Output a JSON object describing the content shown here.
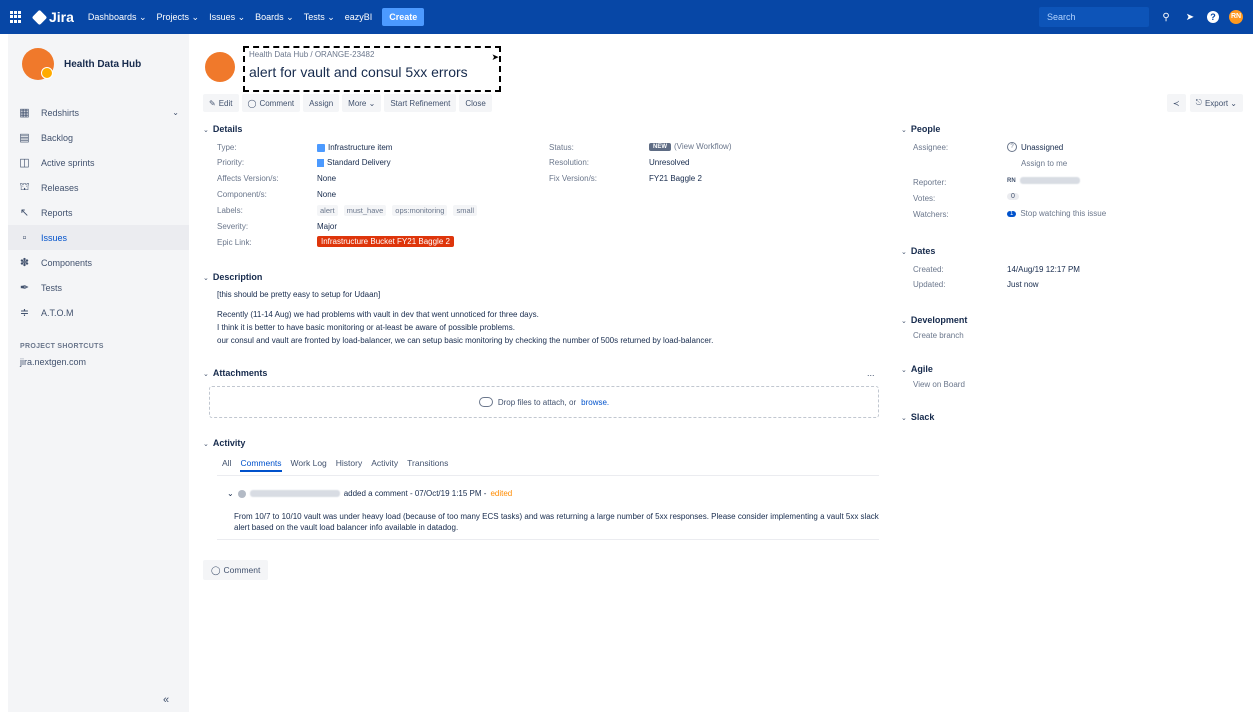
{
  "topnav": {
    "product": "Jira",
    "items": [
      "Dashboards ⌄",
      "Projects ⌄",
      "Issues ⌄",
      "Boards ⌄",
      "Tests ⌄",
      "eazyBI"
    ],
    "create": "Create",
    "search_placeholder": "Search",
    "user_initials": "RN"
  },
  "sidebar": {
    "project_name": "Health Data Hub",
    "items": [
      {
        "label": "Redshirts",
        "icon": "board-icon"
      },
      {
        "label": "Backlog",
        "icon": "backlog-icon"
      },
      {
        "label": "Active sprints",
        "icon": "sprint-icon"
      },
      {
        "label": "Releases",
        "icon": "ship-icon"
      },
      {
        "label": "Reports",
        "icon": "chart-icon"
      },
      {
        "label": "Issues",
        "icon": "issues-icon"
      },
      {
        "label": "Components",
        "icon": "puzzle-icon"
      },
      {
        "label": "Tests",
        "icon": "test-icon"
      },
      {
        "label": "A.T.O.M",
        "icon": "atom-icon"
      }
    ],
    "shortcuts_title": "PROJECT SHORTCUTS",
    "shortcut": "jira.nextgen.com",
    "collapse": "«"
  },
  "issue": {
    "breadcrumb": "Health Data Hub / ORANGE-23482",
    "title": "alert for vault and consul 5xx errors"
  },
  "toolbar": {
    "edit": "Edit",
    "comment": "Comment",
    "assign": "Assign",
    "more": "More ⌄",
    "start_refinement": "Start Refinement",
    "close": "Close",
    "export": "Export ⌄"
  },
  "details": {
    "heading": "Details",
    "type_label": "Type:",
    "type_value": "Infrastructure item",
    "priority_label": "Priority:",
    "priority_value": "Standard Delivery",
    "affects_label": "Affects Version/s:",
    "affects_value": "None",
    "component_label": "Component/s:",
    "component_value": "None",
    "labels_label": "Labels:",
    "labels": [
      "alert",
      "must_have",
      "ops:monitoring",
      "small"
    ],
    "severity_label": "Severity:",
    "severity_value": "Major",
    "epic_label": "Epic Link:",
    "epic_value": "Infrastructure Bucket FY21 Baggle 2",
    "status_label": "Status:",
    "status_badge": "NEW",
    "status_workflow": "(View Workflow)",
    "resolution_label": "Resolution:",
    "resolution_value": "Unresolved",
    "fix_label": "Fix Version/s:",
    "fix_value": "FY21 Baggle 2"
  },
  "description": {
    "heading": "Description",
    "lines": [
      "[this should be pretty easy to setup for Udaan]",
      "Recently (11-14 Aug) we had problems with vault in dev that went unnoticed for three days.",
      "I think it is better to have basic monitoring or at-least be aware of possible problems.",
      "our consul and vault are fronted by load-balancer, we can setup basic monitoring by checking the number of 500s returned by load-balancer."
    ]
  },
  "attachments": {
    "heading": "Attachments",
    "drop_text": "Drop files to attach, or",
    "browse": "browse.",
    "more": "..."
  },
  "activity": {
    "heading": "Activity",
    "tabs": [
      "All",
      "Comments",
      "Work Log",
      "History",
      "Activity",
      "Transitions"
    ],
    "comment_meta": "added a comment - 07/Oct/19 1:15 PM -",
    "edited": "edited",
    "comment_body": "From 10/7 to 10/10 vault was under heavy load (because of too many ECS tasks) and was returning a large number of 5xx responses. Please consider implementing a vault 5xx slack alert based on the vault load balancer info available in datadog.",
    "comment_button": "Comment"
  },
  "people": {
    "heading": "People",
    "assignee_label": "Assignee:",
    "assignee_value": "Unassigned",
    "assign_to_me": "Assign to me",
    "reporter_label": "Reporter:",
    "reporter_initials": "RN",
    "votes_label": "Votes:",
    "votes_value": "0",
    "watchers_label": "Watchers:",
    "watchers_count": "1",
    "watch_text": "Stop watching this issue"
  },
  "dates": {
    "heading": "Dates",
    "created_label": "Created:",
    "created_value": "14/Aug/19 12:17 PM",
    "updated_label": "Updated:",
    "updated_value": "Just now"
  },
  "development": {
    "heading": "Development",
    "link": "Create branch"
  },
  "agile": {
    "heading": "Agile",
    "link": "View on Board"
  },
  "slack": {
    "heading": "Slack"
  },
  "colors": {
    "nav": "#0747a6",
    "accent": "#0052cc",
    "epic": "#de350b",
    "edited": "#ff8b00"
  }
}
